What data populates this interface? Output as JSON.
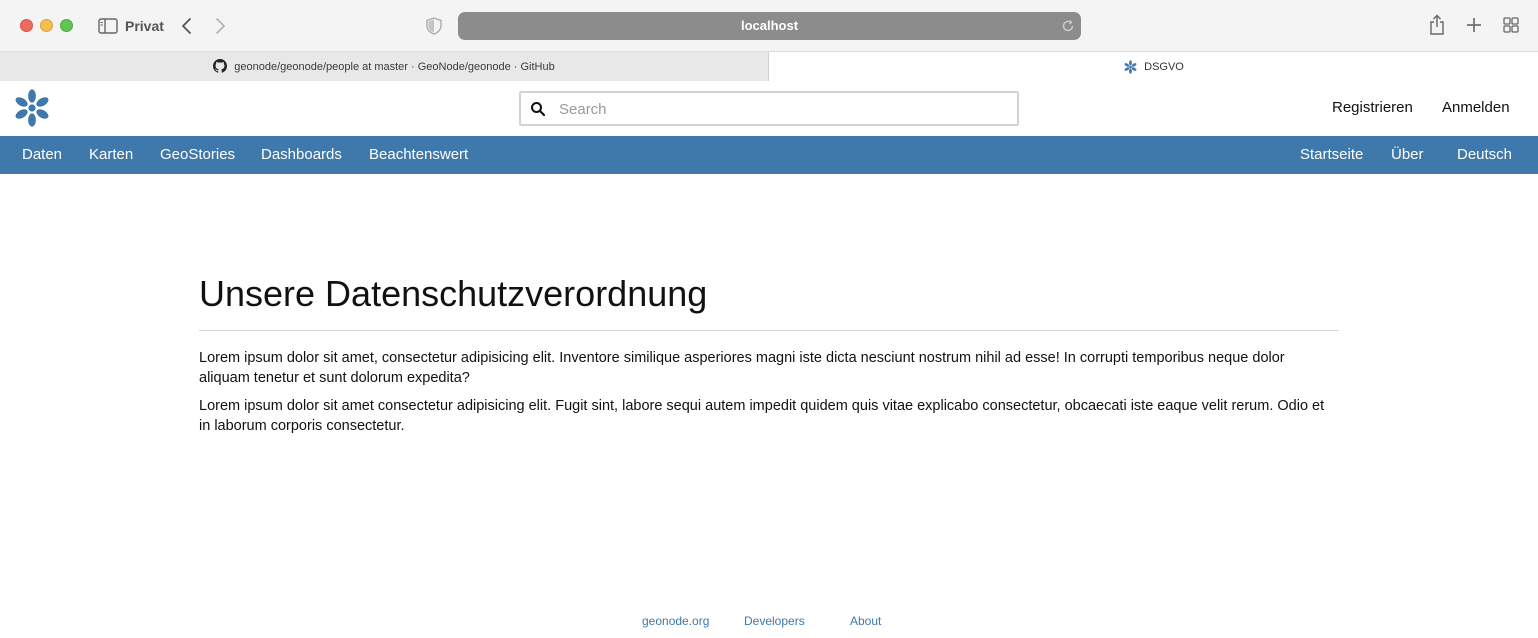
{
  "browser": {
    "private_label": "Privat",
    "url": "localhost",
    "tabs": [
      {
        "title": "geonode/geonode/people at master · GeoNode/geonode · GitHub",
        "favicon": "github-icon",
        "active": false
      },
      {
        "title": "DSGVO",
        "favicon": "geonode-icon",
        "active": true
      }
    ]
  },
  "header": {
    "search_placeholder": "Search",
    "register": "Registrieren",
    "login": "Anmelden"
  },
  "nav": {
    "left": [
      "Daten",
      "Karten",
      "GeoStories",
      "Dashboards",
      "Beachtenswert"
    ],
    "right": [
      "Startseite",
      "Über",
      "Deutsch"
    ]
  },
  "content": {
    "title": "Unsere Datenschutzverordnung",
    "paragraphs": [
      "Lorem ipsum dolor sit amet, consectetur adipisicing elit. Inventore similique asperiores magni iste dicta nesciunt nostrum nihil ad esse! In corrupti temporibus neque dolor aliquam tenetur et sunt dolorum expedita?",
      "Lorem ipsum dolor sit amet consectetur adipisicing elit. Fugit sint, labore sequi autem impedit quidem quis vitae explicabo consectetur, obcaecati iste eaque velit rerum. Odio et in laborum corporis consectetur."
    ]
  },
  "footer": {
    "links": [
      "geonode.org",
      "Developers",
      "About"
    ]
  },
  "colors": {
    "brand": "#3f78aa",
    "url_bar": "#8c8c8c"
  }
}
